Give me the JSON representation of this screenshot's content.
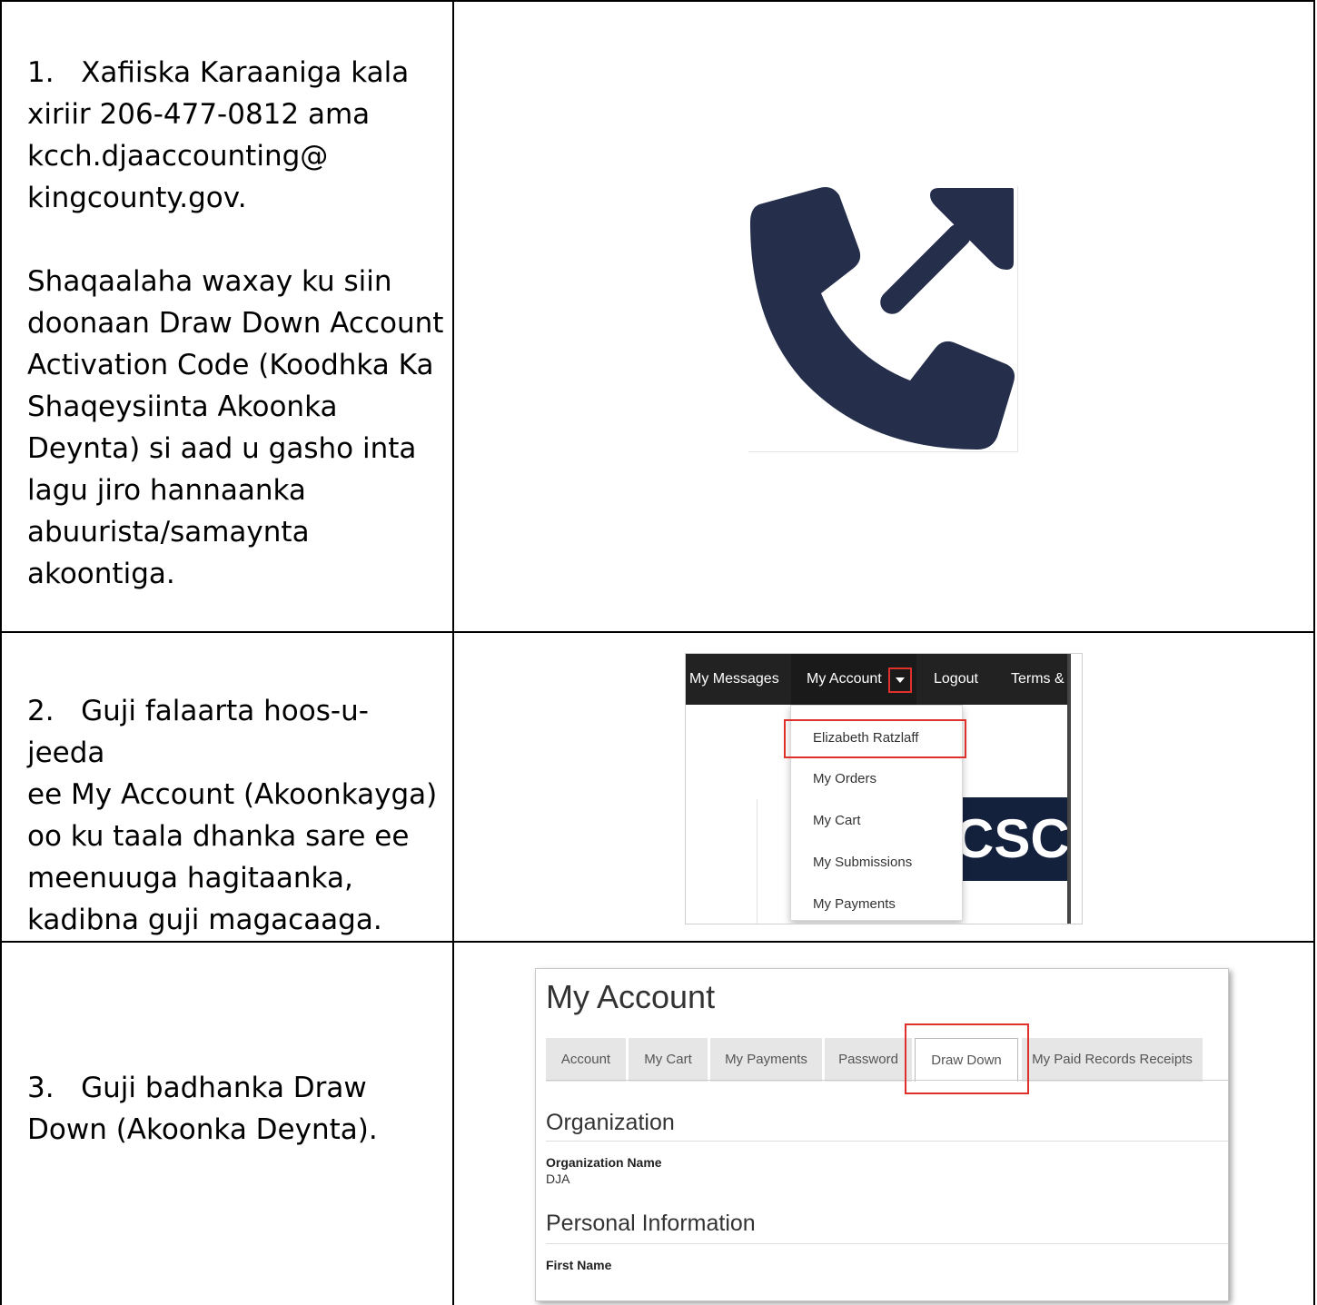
{
  "rows": [
    {
      "number": "1.",
      "paragraphs": [
        [
          "Xafiiska Karaaniga kala",
          "xiriir 206-477-0812 ama",
          "kcch.djaaccounting@",
          "kingcounty.gov."
        ],
        [
          "Shaqaalaha waxay ku siin",
          "doonaan Draw Down Account",
          "Activation Code (Koodhka Ka",
          "Shaqeysiinta Akoonka",
          "Deynta) si aad u gasho inta",
          "lagu jiro hannaanka",
          "abuurista/samaynta",
          "akoontiga."
        ]
      ],
      "image": {
        "icon": "phone-outgoing-icon",
        "color": "#252e4b"
      }
    },
    {
      "number": "2.",
      "lines": [
        "Guji falaarta hoos-u-jeeda",
        "ee My Account (Akoonkayga)",
        "oo ku taala dhanka sare ee",
        "meenuuga hagitaanka,",
        "kadibna guji magacaaga."
      ],
      "screenshot": {
        "nav": [
          "My Messages",
          "My Account",
          "Logout",
          "Terms & C"
        ],
        "dropdown": [
          "Elizabeth Ratzlaff",
          "My Orders",
          "My Cart",
          "My Submissions",
          "My Payments"
        ],
        "banner_text": "CSCF",
        "highlight_color": "#e0302b"
      }
    },
    {
      "number": "3.",
      "lines": [
        "Guji badhanka Draw",
        "Down (Akoonka Deynta)."
      ],
      "screenshot": {
        "title": "My Account",
        "tabs": [
          "Account",
          "My Cart",
          "My Payments",
          "Password",
          "Draw Down",
          "My Paid Records Receipts"
        ],
        "active_tab": "Draw Down",
        "section1": "Organization",
        "org_label": "Organization Name",
        "org_value": "DJA",
        "section2": "Personal Information",
        "first_name_label": "First Name"
      }
    }
  ]
}
